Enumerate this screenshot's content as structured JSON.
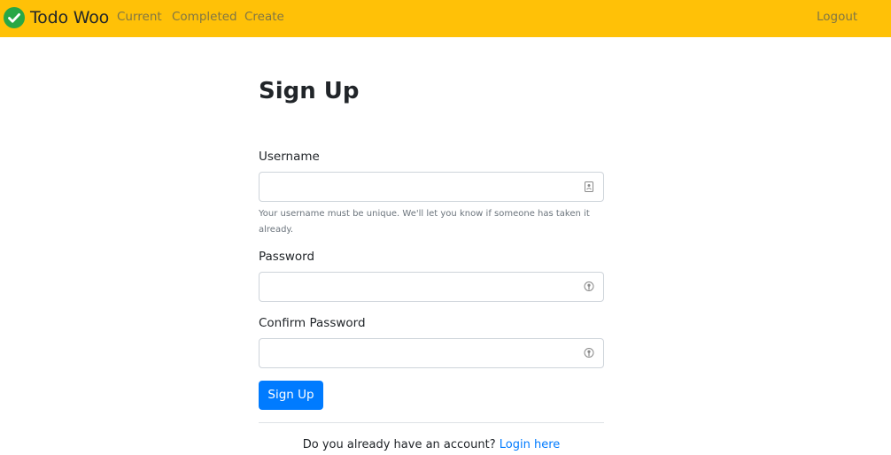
{
  "navbar": {
    "brand": "Todo Woo",
    "brand_icon": "check-circle-icon",
    "links": {
      "current": "Current",
      "completed": "Completed",
      "create": "Create",
      "logout": "Logout"
    },
    "background": "#ffc107"
  },
  "form": {
    "title": "Sign Up",
    "username": {
      "label": "Username",
      "value": "",
      "help": "Your username must be unique. We'll let you know if someone has taken it already.",
      "icon": "contact-card-icon"
    },
    "password": {
      "label": "Password",
      "value": "",
      "icon": "key-icon"
    },
    "confirm_password": {
      "label": "Confirm Password",
      "value": "",
      "icon": "key-icon"
    },
    "submit_label": "Sign Up",
    "submit_color": "#007bff"
  },
  "footer": {
    "prompt": "Do you already have an account?",
    "link": "Login here",
    "link_color": "#007bff"
  }
}
